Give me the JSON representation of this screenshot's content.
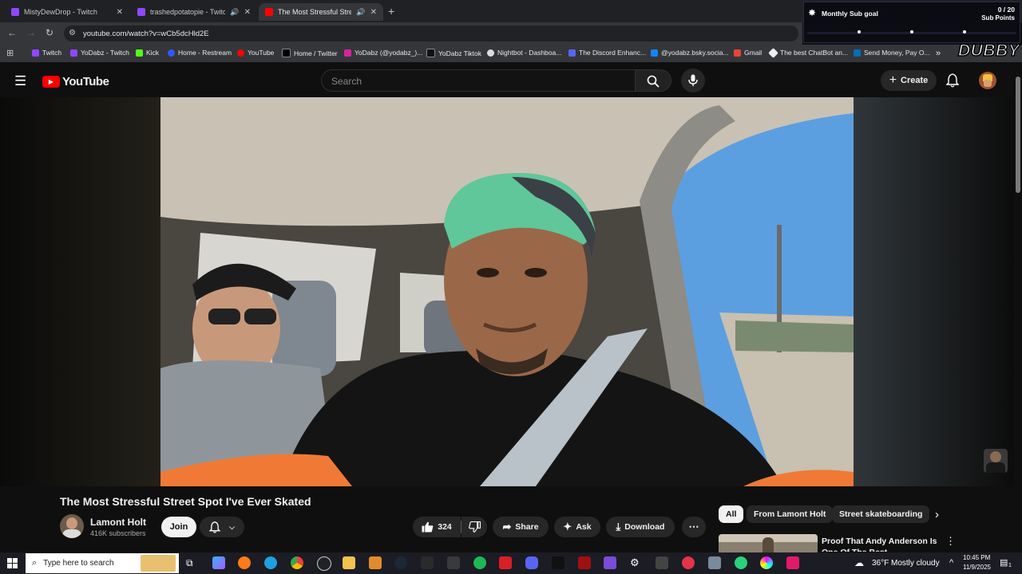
{
  "browser": {
    "tabs": [
      {
        "label": "MistyDewDrop - Twitch",
        "active": false,
        "audio": false
      },
      {
        "label": "trashedpotatopie - Twitch",
        "active": false,
        "audio": true
      },
      {
        "label": "The Most Stressful Street Sp",
        "active": true,
        "audio": true
      }
    ],
    "new_tab": "+",
    "url": "youtube.com/watch?v=wCb5dcHld2E",
    "bookmarks": [
      "Twitch",
      "YoDabz - Twitch",
      "Kick",
      "Home - Restream",
      "YouTube",
      "Home / Twitter",
      "YoDabz (@yodabz_)...",
      "YoDabz Tiktok",
      "Nightbot - Dashboa...",
      "The Discord Enhanc...",
      "@yodabz.bsky.socia...",
      "Gmail",
      "The best ChatBot an...",
      "Send Money, Pay O..."
    ],
    "bookmarks_more": "»"
  },
  "overlay": {
    "goal_title": "Monthly Sub goal",
    "goal_count": "0 / 20",
    "goal_unit": "Sub Points",
    "progress": 0,
    "brand": "DUBBY"
  },
  "youtube": {
    "logo_text": "YouTube",
    "search_placeholder": "Search",
    "create_label": "Create"
  },
  "video": {
    "title": "The Most Stressful Street Spot I've Ever Skated",
    "channel": "Lamont Holt",
    "subscribers": "416K subscribers",
    "join_label": "Join",
    "likes": "324",
    "share_label": "Share",
    "ask_label": "Ask",
    "download_label": "Download"
  },
  "chips": [
    "All",
    "From Lamont Holt",
    "Street skateboarding"
  ],
  "related": {
    "title": "Proof That Andy Anderson Is One Of The Best Skateboarder..."
  },
  "taskbar": {
    "search_placeholder": "Type here to search",
    "weather": "36°F  Mostly cloudy",
    "time": "10:45 PM",
    "date": "11/9/2025",
    "notifications": "1"
  },
  "colors": {
    "youtube_red": "#ff0000",
    "chrome_dark": "#202124",
    "chrome_toolbar": "#35363a",
    "yt_bg": "#0f0f0f",
    "chip_bg": "#272727"
  }
}
